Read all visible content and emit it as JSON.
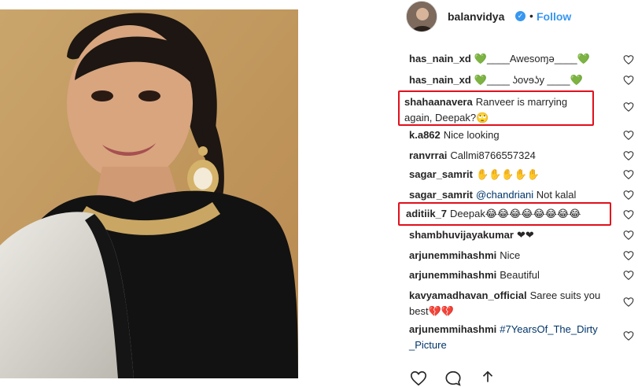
{
  "post": {
    "photo_alt_icon": "portrait-photo"
  },
  "header": {
    "username": "balanvidya",
    "verified_icon": "verified-badge-icon",
    "separator": "•",
    "follow_label": "Follow"
  },
  "comments": [
    {
      "user": "has_nain_xd",
      "text": "💚____Awesoɱә____💚"
    },
    {
      "user": "has_nain_xd",
      "text": "💚____ ʖovɘʖy ____💚"
    },
    {
      "user": "shahaanavera",
      "text": "Ranveer is marrying again, Deepak?🙄"
    },
    {
      "user": "k.a862",
      "text": "Nice looking"
    },
    {
      "user": "ranvrrai",
      "text": "Callmi8766557324"
    },
    {
      "user": "sagar_samrit",
      "text": "✋✋✋✋✋"
    },
    {
      "user": "sagar_samrit",
      "text": "@chandriani",
      "text2": " Not kalal"
    },
    {
      "user": "aditiik_7",
      "text": "Deepak😂😂😂😂😂😂😂😂"
    },
    {
      "user": "shambhuvijayakumar",
      "text": "❤❤"
    },
    {
      "user": "arjunemmihashmi",
      "text": "Nice"
    },
    {
      "user": "arjunemmihashmi",
      "text": "Beautiful"
    },
    {
      "user": "kavyamadhavan_official",
      "text": "Saree suits you best💔💔"
    },
    {
      "user": "arjunemmihashmi",
      "text": "#7YearsOf_The_Dirty_Picture"
    }
  ],
  "colors": {
    "highlight_border": "#e0101c",
    "link": "#3897f0",
    "hashtag": "#003569"
  },
  "actions": {
    "like_icon": "heart-outline-icon",
    "comment_icon": "comment-bubble-icon",
    "share_icon": "share-arrow-icon"
  }
}
